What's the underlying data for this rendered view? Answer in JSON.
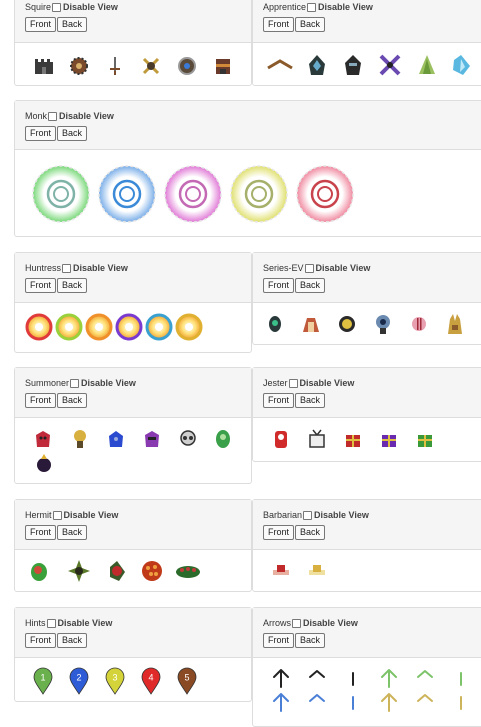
{
  "labels": {
    "disable_view": "Disable View",
    "front": "Front",
    "back": "Back"
  },
  "panels": {
    "squire": {
      "title": "Squire",
      "icons": [
        "castle-tower-icon",
        "spiked-gear-icon",
        "sword-icon",
        "crossed-shield-icon",
        "round-shield-icon",
        "armored-barricade-icon"
      ]
    },
    "apprentice": {
      "title": "Apprentice",
      "icons": [
        "magic-staff-icon",
        "dark-hood-icon",
        "dark-helmet-icon",
        "crossed-blades-icon",
        "green-crystal-icon",
        "ice-crystal-icon"
      ]
    },
    "monk": {
      "title": "Monk",
      "icons": [
        "green-aura-medallion-icon",
        "lightning-aura-medallion-icon",
        "healing-aura-medallion-icon",
        "enrage-aura-medallion-icon",
        "mystery-aura-medallion-icon"
      ]
    },
    "huntress": {
      "title": "Huntress",
      "icons": [
        "red-trap-icon",
        "green-trap-icon",
        "orange-trap-icon",
        "purple-trap-icon",
        "blue-trap-icon",
        "gold-trap-icon"
      ]
    },
    "series_ev": {
      "title": "Series-EV",
      "icons": [
        "green-node-icon",
        "red-beam-icon",
        "yellow-disc-icon",
        "blue-reflector-icon",
        "red-striped-pod-icon",
        "gold-tower-icon"
      ]
    },
    "summoner": {
      "title": "Summoner",
      "icons": [
        "red-minion-icon",
        "gold-minion-icon",
        "blue-minion-icon",
        "purple-minion-icon",
        "skull-minion-icon",
        "green-minion-icon",
        "dark-bomb-minion-icon"
      ]
    },
    "jester": {
      "title": "Jester",
      "icons": [
        "red-wheel-icon",
        "white-gift-icon",
        "red-gift-icon",
        "purple-gift-icon",
        "green-gift-icon"
      ]
    },
    "hermit": {
      "title": "Hermit",
      "icons": [
        "green-frog-icon",
        "thorn-flower-icon",
        "red-rose-icon",
        "ember-orb-icon",
        "green-caterpillar-icon"
      ]
    },
    "barbarian": {
      "title": "Barbarian",
      "icons": [
        "red-horn-icon",
        "gold-horn-icon"
      ]
    },
    "hints": {
      "title": "Hints",
      "icons": [
        {
          "name": "hint-marker-1-icon",
          "label": "1",
          "color": "#6ab04c"
        },
        {
          "name": "hint-marker-2-icon",
          "label": "2",
          "color": "#2e5cd6"
        },
        {
          "name": "hint-marker-3-icon",
          "label": "3",
          "color": "#d4d43a"
        },
        {
          "name": "hint-marker-4-icon",
          "label": "4",
          "color": "#e02a2a"
        },
        {
          "name": "hint-marker-5-icon",
          "label": "5",
          "color": "#8a4a24"
        }
      ]
    },
    "arrows": {
      "title": "Arrows",
      "icons": [
        {
          "name": "black-arrow-up-icon",
          "color": "#222222"
        },
        {
          "name": "black-chevron-up-icon",
          "color": "#222222"
        },
        {
          "name": "black-line-icon",
          "color": "#222222"
        },
        {
          "name": "green-arrow-up-icon",
          "color": "#7cc36a"
        },
        {
          "name": "green-chevron-up-icon",
          "color": "#7cc36a"
        },
        {
          "name": "green-line-icon",
          "color": "#7cc36a"
        },
        {
          "name": "blue-arrow-up-icon",
          "color": "#4a7fd6"
        },
        {
          "name": "blue-chevron-up-icon",
          "color": "#4a7fd6"
        },
        {
          "name": "blue-line-icon",
          "color": "#4a7fd6"
        },
        {
          "name": "gold-arrow-up-icon",
          "color": "#cdb35a"
        },
        {
          "name": "gold-chevron-up-icon",
          "color": "#cdb35a"
        },
        {
          "name": "gold-line-icon",
          "color": "#cdb35a"
        }
      ]
    }
  },
  "colors": {
    "monk_glows": [
      "#7ad87a",
      "#7aaee8",
      "#e07ad6",
      "#e0e070",
      "#f08aa0"
    ],
    "monk_centers": [
      "#7fb3a8",
      "#3b8ad8",
      "#c46ab5",
      "#a6b06a",
      "#c9434d"
    ]
  }
}
